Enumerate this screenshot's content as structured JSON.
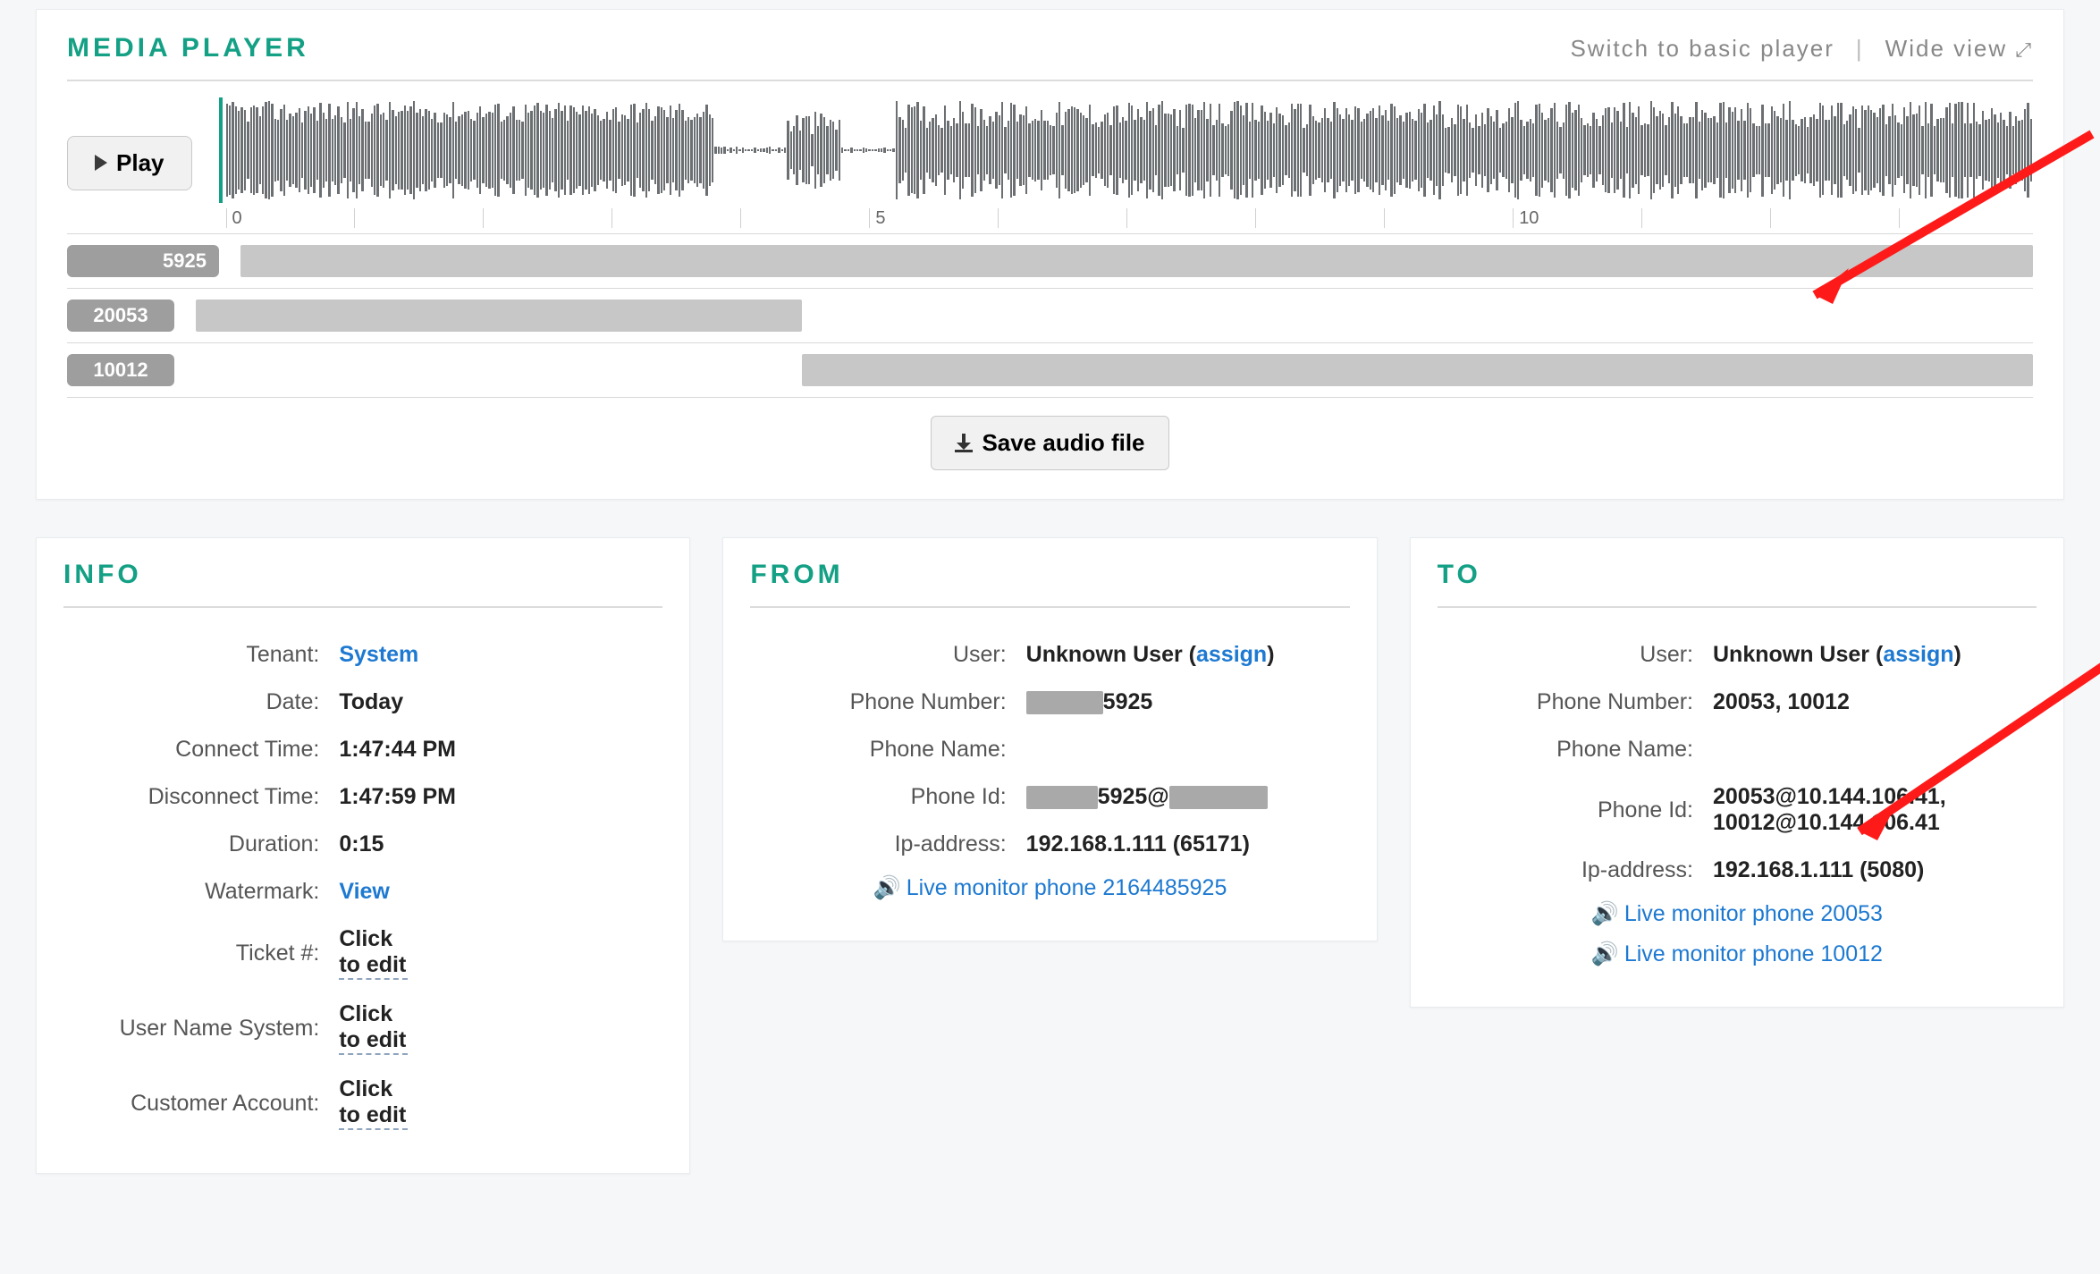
{
  "player": {
    "title": "MEDIA PLAYER",
    "switch_basic": "Switch to basic player",
    "wide_view": "Wide view",
    "play_label": "Play",
    "ticks": [
      "0",
      "5",
      "10"
    ],
    "tracks": [
      {
        "label": "5925",
        "left_pct": 0,
        "width_pct": 100,
        "redact_prefix": true
      },
      {
        "label": "20053",
        "left_pct": 0,
        "width_pct": 33,
        "redact_prefix": false
      },
      {
        "label": "10012",
        "left_pct": 33,
        "width_pct": 67,
        "redact_prefix": false
      }
    ],
    "save_label": "Save audio file"
  },
  "info": {
    "title": "INFO",
    "rows": {
      "tenant_label": "Tenant:",
      "tenant_value": "System",
      "date_label": "Date:",
      "date_value": "Today",
      "connect_label": "Connect Time:",
      "connect_value": "1:47:44 PM",
      "disconnect_label": "Disconnect Time:",
      "disconnect_value": "1:47:59 PM",
      "duration_label": "Duration:",
      "duration_value": "0:15",
      "watermark_label": "Watermark:",
      "watermark_value": "View",
      "ticket_label": "Ticket #:",
      "ticket_value": "Click to edit",
      "uname_label": "User Name System:",
      "uname_value": "Click to edit",
      "acct_label": "Customer Account:",
      "acct_value": "Click to edit"
    }
  },
  "from": {
    "title": "FROM",
    "user_label": "User:",
    "user_value": "Unknown User",
    "assign": "assign",
    "phone_num_label": "Phone Number:",
    "phone_num_value": "5925",
    "phone_name_label": "Phone Name:",
    "phone_name_value": "",
    "phone_id_label": "Phone Id:",
    "phone_id_value": "5925@",
    "ip_label": "Ip-address:",
    "ip_value": "192.168.1.111 (65171)",
    "live_monitor": "Live monitor phone 2164485925"
  },
  "to": {
    "title": "TO",
    "user_label": "User:",
    "user_value": "Unknown User",
    "assign": "assign",
    "phone_num_label": "Phone Number:",
    "phone_num_value": "20053, 10012",
    "phone_name_label": "Phone Name:",
    "phone_name_value": "",
    "phone_id_label": "Phone Id:",
    "phone_id_value": "20053@10.144.106.41, 10012@10.144.106.41",
    "ip_label": "Ip-address:",
    "ip_value": "192.168.1.111 (5080)",
    "live_monitor_1": "Live monitor phone 20053",
    "live_monitor_2": "Live monitor phone 10012"
  }
}
